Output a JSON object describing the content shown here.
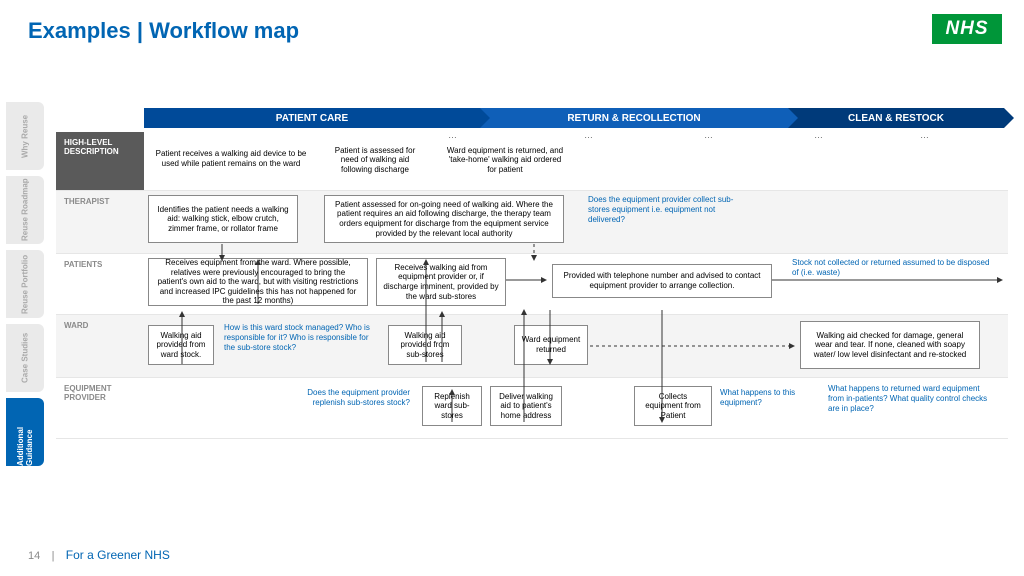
{
  "title": "Examples | Workflow map",
  "logo": "NHS",
  "tabs": [
    {
      "label": "Why Reuse"
    },
    {
      "label": "Reuse Roadmap"
    },
    {
      "label": "Reuse Portfolio"
    },
    {
      "label": "Case Studies"
    },
    {
      "label": "Additional Guidance"
    }
  ],
  "phases": {
    "p1": "PATIENT CARE",
    "p2": "RETURN & RECOLLECTION",
    "p3": "CLEAN & RESTOCK"
  },
  "rowlabels": {
    "r1": "HIGH-LEVEL DESCRIPTION",
    "r2": "THERAPIST",
    "r3": "PATIENTS",
    "r4": "WARD",
    "r5": "EQUIPMENT PROVIDER"
  },
  "boxes": {
    "hl1": "Patient receives a walking aid device to be used while patient remains on the ward",
    "hl2": "Patient is assessed for need of walking aid following discharge",
    "hl3": "Ward equipment is returned, and 'take-home' walking aid ordered for patient",
    "t1": "Identifies the patient needs a walking aid: walking stick, elbow crutch, zimmer frame, or rollator frame",
    "t2": "Patient assessed for on-going need of walking aid. Where the patient requires an aid following discharge, the therapy team orders equipment for discharge from the equipment service provided by the relevant local authority",
    "p1": "Receives equipment from the ward. Where possible, relatives were previously encouraged to bring the patient's own aid to the ward, but with visiting restrictions and increased IPC guidelines this has not happened for the past 12 months)",
    "p2": "Receives walking aid from equipment provider or, if discharge imminent, provided by the ward sub-stores",
    "p3": "Provided with telephone number  and advised to contact equipment provider to arrange collection.",
    "w1": "Walking aid provided from ward stock.",
    "w2": "Walking aid provided from sub-stores",
    "w3": "Ward equipment returned",
    "w4": "Walking aid checked for damage, general wear and tear. If none, cleaned with soapy water/ low level disinfectant and re-stocked",
    "e1": "Replenish ward sub-stores",
    "e2": "Deliver walking aid to patient's home address",
    "e3": "Collects equipment from Patient"
  },
  "notes": {
    "n1": "Does the equipment provider collect sub-stores equipment i.e. equipment not delivered?",
    "n2": "Stock not collected or returned assumed to be disposed of (i.e. waste)",
    "n3": "How is this ward stock managed? Who is responsible for it? Who is responsible for the sub-store stock?",
    "n4": "Does the equipment provider replenish sub-stores stock?",
    "n5": "What happens to this equipment?",
    "n6": "What happens to returned ward equipment from in-patients? What quality control checks are in place?"
  },
  "footer": {
    "page": "14",
    "sep": "|",
    "text": "For a Greener NHS"
  }
}
